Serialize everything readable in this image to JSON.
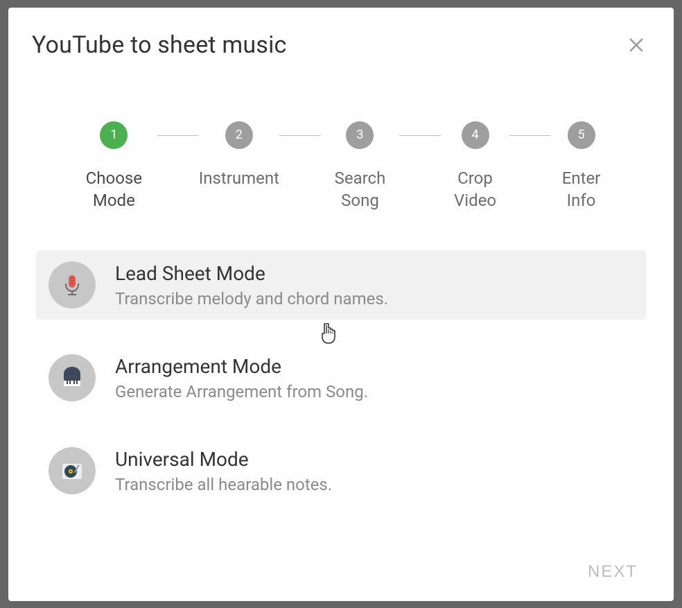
{
  "modal": {
    "title": "YouTube to sheet music"
  },
  "stepper": {
    "steps": [
      {
        "num": "1",
        "label": "Choose Mode",
        "active": true
      },
      {
        "num": "2",
        "label": "Instrument",
        "active": false
      },
      {
        "num": "3",
        "label": "Search Song",
        "active": false
      },
      {
        "num": "4",
        "label": "Crop Video",
        "active": false
      },
      {
        "num": "5",
        "label": "Enter Info",
        "active": false
      }
    ]
  },
  "options": [
    {
      "icon": "microphone-icon",
      "title": "Lead Sheet Mode",
      "description": "Transcribe melody and chord names.",
      "selected": true
    },
    {
      "icon": "piano-icon",
      "title": "Arrangement Mode",
      "description": "Generate Arrangement from Song.",
      "selected": false
    },
    {
      "icon": "turntable-icon",
      "title": "Universal Mode",
      "description": "Transcribe all hearable notes.",
      "selected": false
    }
  ],
  "footer": {
    "next_label": "NEXT"
  }
}
